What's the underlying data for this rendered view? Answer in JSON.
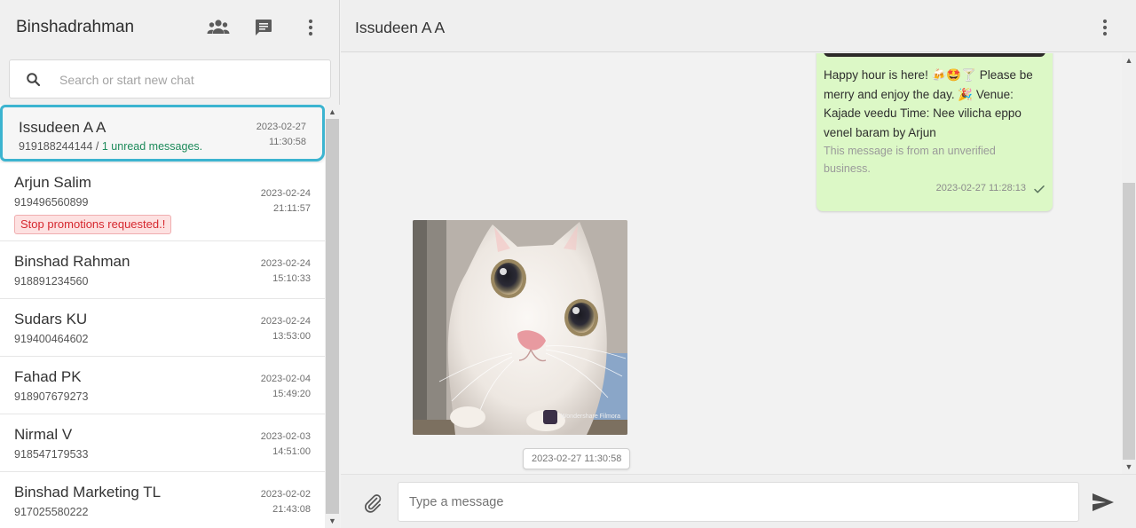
{
  "sidebar": {
    "title": "Binshadrahman",
    "icons": {
      "contacts": "people-icon",
      "new_chat": "chat-icon",
      "menu": "more-vertical-icon"
    },
    "search": {
      "placeholder": "Search or start new chat",
      "value": ""
    },
    "chats": [
      {
        "name": "Issudeen A A",
        "phone": "919188244144",
        "separator": " / ",
        "unread": "1 unread messages.",
        "date": "2023-02-27",
        "time": "11:30:58",
        "active": true
      },
      {
        "name": "Arjun Salim",
        "phone": "919496560899",
        "badge": "Stop promotions requested.!",
        "date": "2023-02-24",
        "time": "21:11:57"
      },
      {
        "name": "Binshad Rahman",
        "phone": "918891234560",
        "date": "2023-02-24",
        "time": "15:10:33"
      },
      {
        "name": "Sudars KU",
        "phone": "919400464602",
        "date": "2023-02-24",
        "time": "13:53:00"
      },
      {
        "name": "Fahad PK",
        "phone": "918907679273",
        "date": "2023-02-04",
        "time": "15:49:20"
      },
      {
        "name": "Nirmal V",
        "phone": "918547179533",
        "date": "2023-02-03",
        "time": "14:51:00"
      },
      {
        "name": "Binshad Marketing TL",
        "phone": "917025580222",
        "date": "2023-02-02",
        "time": "21:43:08"
      }
    ]
  },
  "conversation": {
    "contact_name": "Issudeen A A",
    "outgoing": {
      "text": "Happy hour is here! 🍻🤩🍸 Please be merry and enjoy the day. 🎉 Venue: Kajade veedu Time: Nee vilicha eppo venel baram by Arjun",
      "note": "This message is from an unverified business.",
      "timestamp": "2023-02-27 11:28:13",
      "status_icon": "check-icon"
    },
    "incoming_image": {
      "subject": "white kitten photo",
      "watermark": "Wondershare Filmora"
    },
    "incoming_timestamp": "2023-02-27 11:30:58"
  },
  "composer": {
    "placeholder": "Type a message",
    "value": "",
    "attach_icon": "paperclip-icon",
    "send_icon": "send-icon"
  },
  "colors": {
    "active_border": "#3cb4d0",
    "unread_text": "#1d8a5a",
    "outgoing_bubble": "#dcf8c6",
    "promo_badge_text": "#d6282f"
  }
}
